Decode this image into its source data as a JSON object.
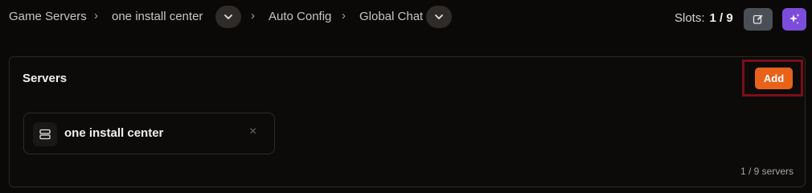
{
  "breadcrumb": {
    "items": [
      "Game Servers",
      "one install center",
      "Auto Config",
      "Global Chat"
    ],
    "separator": "›"
  },
  "slots": {
    "label": "Slots:",
    "value": "1 / 9"
  },
  "icons": {
    "edit": "edit-icon",
    "ai": "sparkles-icon",
    "chevron": "chevron-down-icon",
    "server": "server-icon",
    "close": "close-icon"
  },
  "panel": {
    "title": "Servers",
    "add_label": "Add",
    "servers": [
      {
        "name": "one install center",
        "remove": "×"
      }
    ],
    "count_text": "1 / 9 servers"
  },
  "colors": {
    "accent": "#e8621a",
    "ai_button": "#7c4ddb",
    "highlight": "#7c0e1a"
  }
}
